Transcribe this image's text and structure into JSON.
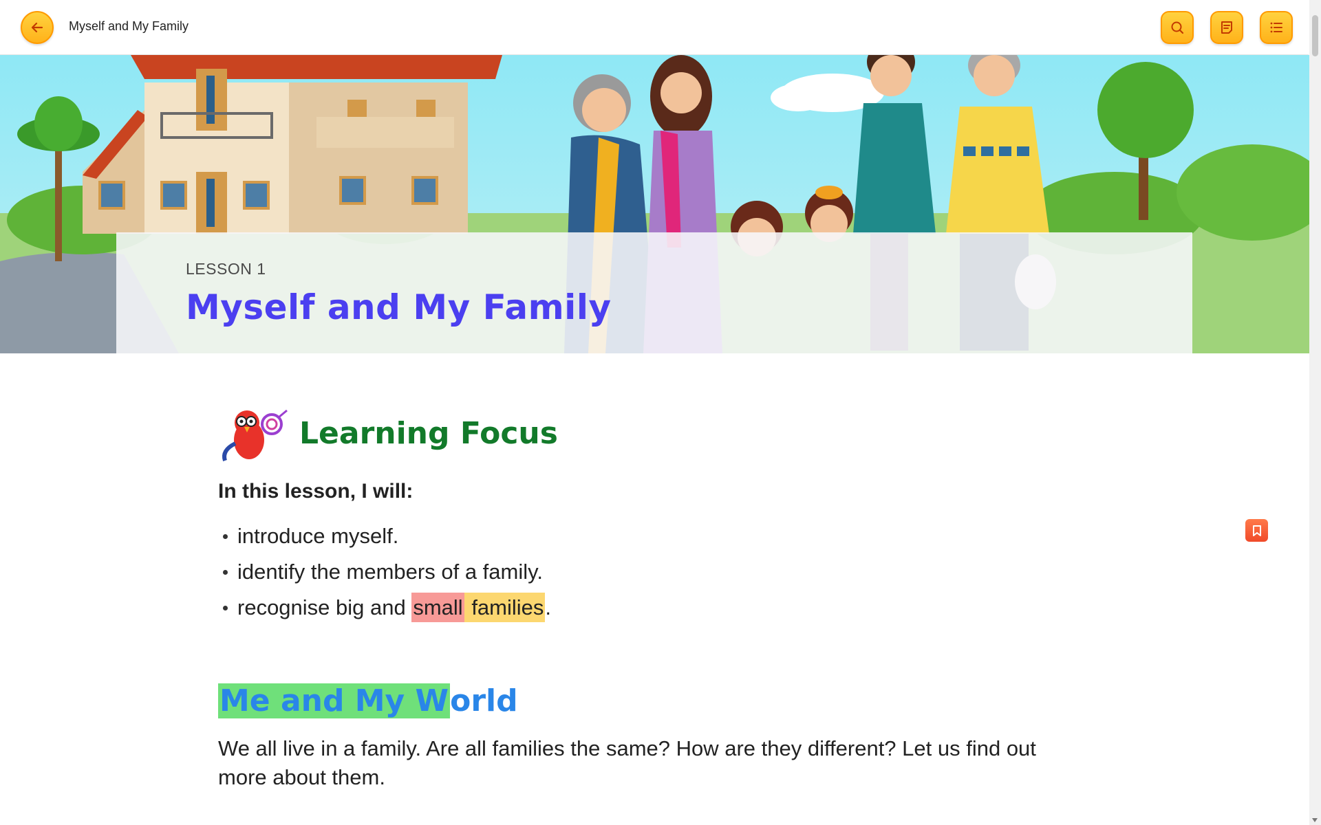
{
  "header": {
    "title": "Myself and My Family",
    "back_icon": "arrow-left-icon",
    "search_icon": "search-icon",
    "notes_icon": "notes-icon",
    "toc_icon": "list-icon",
    "accent": "#ffb21a"
  },
  "hero": {
    "lesson_label": "LESSON 1",
    "lesson_title": "Myself and My Family",
    "title_color": "#4b3ff0"
  },
  "learning_focus": {
    "title": "Learning Focus",
    "title_color": "#127a2a",
    "intro": "In this lesson, I will:",
    "items": [
      {
        "text": "introduce myself."
      },
      {
        "text": "identify the members of a family."
      },
      {
        "prefix": "recognise big and ",
        "highlight1": "small",
        "space": " ",
        "highlight2": "families",
        "suffix": "."
      }
    ],
    "highlight_colors": [
      "#f79a97",
      "#fcd770"
    ]
  },
  "section": {
    "title_highlighted": "Me and My W",
    "title_rest": "orld",
    "title_color": "#2a86e8",
    "highlight_color": "#6fe07a",
    "paragraph": "We all live in a family. Are all families the same? How are they different? Let us find out more about them."
  },
  "side_bookmark": {
    "icon": "bookmark-icon",
    "color": "#f04a2a"
  }
}
